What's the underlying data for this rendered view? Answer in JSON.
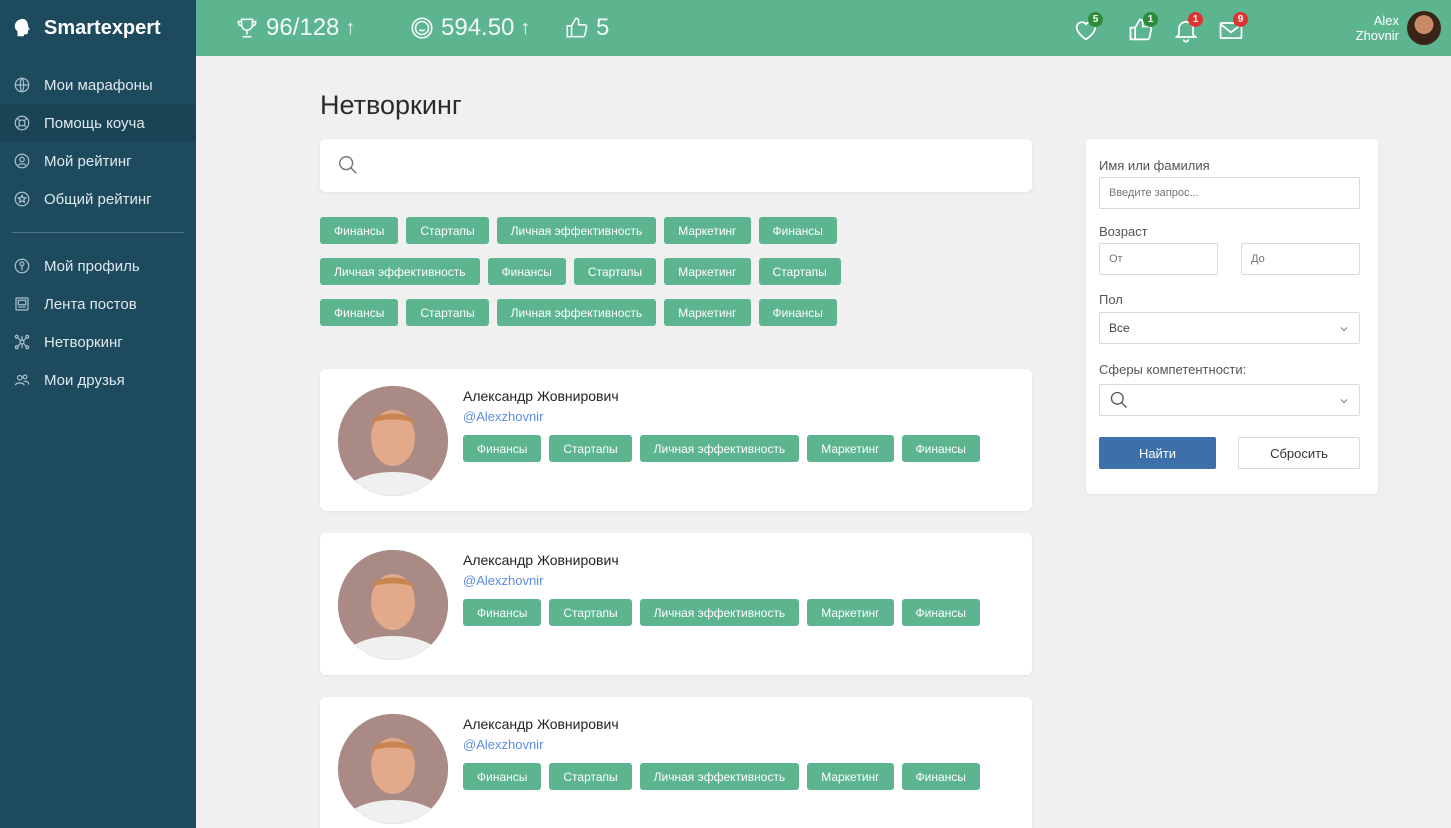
{
  "app": {
    "name": "Smartexpert"
  },
  "sidebar": {
    "items_top": [
      {
        "label": "Мои марафоны",
        "icon": "globe-icon"
      },
      {
        "label": "Помощь коуча",
        "icon": "lifebuoy-icon"
      },
      {
        "label": "Мой рейтинг",
        "icon": "rating-user-icon"
      },
      {
        "label": "Общий рейтинг",
        "icon": "star-circle-icon"
      }
    ],
    "items_bottom": [
      {
        "label": "Мой профиль",
        "icon": "profile-icon"
      },
      {
        "label": "Лента постов",
        "icon": "feed-icon"
      },
      {
        "label": "Нетворкинг",
        "icon": "network-icon"
      },
      {
        "label": "Мои друзья",
        "icon": "friends-icon"
      }
    ]
  },
  "topbar": {
    "trophy_stat": "96/128",
    "coins_stat": "594.50",
    "likes_stat": "5",
    "trend_arrow": "↑",
    "notifications": [
      {
        "icon": "heart-icon",
        "count": "5",
        "color": "#2e8b3a"
      },
      {
        "icon": "thumbs-up-icon",
        "count": "1",
        "color": "#2e8b3a"
      },
      {
        "icon": "bell-icon",
        "count": "1",
        "color": "#e03333"
      },
      {
        "icon": "mail-icon",
        "count": "9",
        "color": "#e03333"
      }
    ],
    "user_first": "Alex",
    "user_last": "Zhovnir"
  },
  "main": {
    "title": "Нетворкинг",
    "tag_rows": [
      [
        "Финансы",
        "Стартапы",
        "Личная эффективность",
        "Маркетинг",
        "Финансы"
      ],
      [
        "Личная эффективность",
        "Финансы",
        "Стартапы",
        "Маркетинг",
        "Стартапы"
      ],
      [
        "Финансы",
        "Стартапы",
        "Личная эффективность",
        "Маркетинг",
        "Финансы"
      ]
    ],
    "cards": [
      {
        "name": "Александр Жовнирович",
        "handle": "@Alexzhovnir",
        "tags": [
          "Финансы",
          "Стартапы",
          "Личная эффективность",
          "Маркетинг",
          "Финансы"
        ]
      },
      {
        "name": "Александр Жовнирович",
        "handle": "@Alexzhovnir",
        "tags": [
          "Финансы",
          "Стартапы",
          "Личная эффективность",
          "Маркетинг",
          "Финансы"
        ]
      },
      {
        "name": "Александр Жовнирович",
        "handle": "@Alexzhovnir",
        "tags": [
          "Финансы",
          "Стартапы",
          "Личная эффективность",
          "Маркетинг",
          "Финансы"
        ]
      }
    ]
  },
  "filter": {
    "name_label": "Имя или фамилия",
    "name_placeholder": "Введите запрос...",
    "age_label": "Возраст",
    "age_from_placeholder": "От",
    "age_to_placeholder": "До",
    "gender_label": "Пол",
    "gender_value": "Все",
    "spheres_label": "Сферы компетентности:",
    "find_button": "Найти",
    "reset_button": "Сбросить"
  },
  "colors": {
    "sidebar": "#1e4a5e",
    "topbar": "#5cb58e",
    "tag": "#5cb58e",
    "primary_button": "#3d6fa8",
    "handle_link": "#5b8de0"
  }
}
